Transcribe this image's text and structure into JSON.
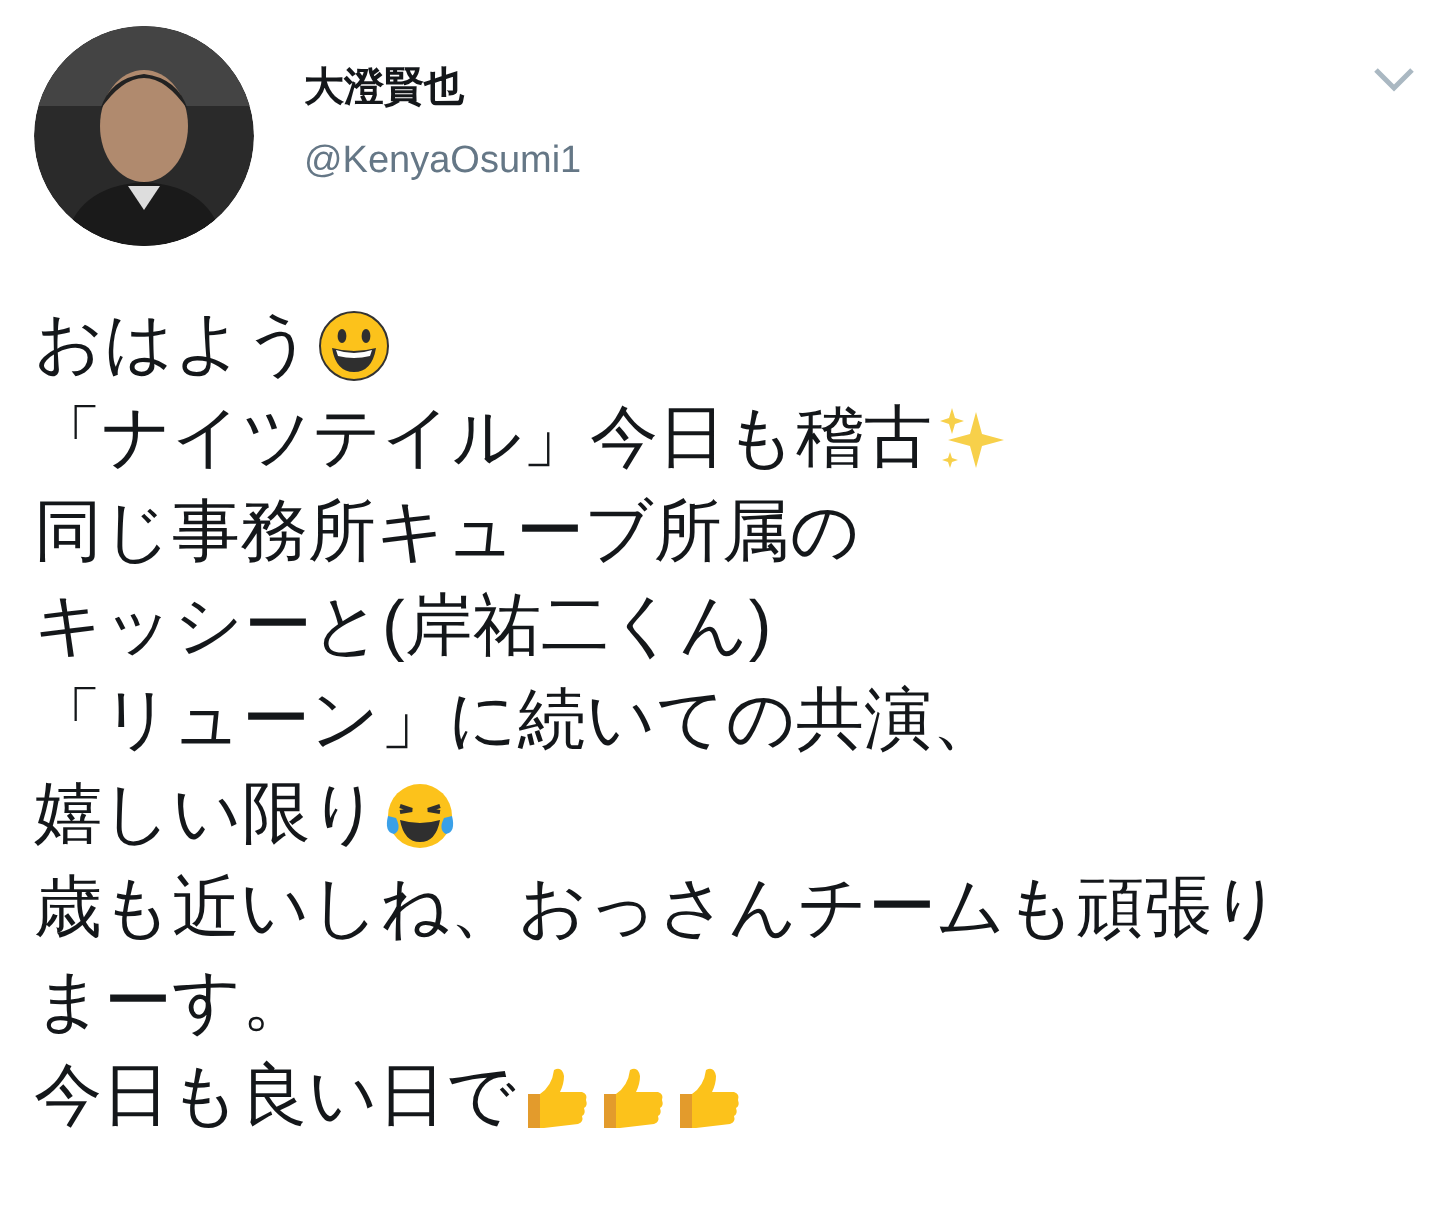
{
  "author": {
    "name": "大澄賢也",
    "handle": "@KenyaOsumi1"
  },
  "lines": [
    {
      "text": "おはよう",
      "emoji": [
        {
          "kind": "grin"
        }
      ]
    },
    {
      "text": "「ナイツテイル」今日も稽古",
      "emoji": [
        {
          "kind": "sparkles"
        }
      ]
    },
    {
      "text": "同じ事務所キューブ所属の"
    },
    {
      "text": "キッシーと(岸祐二くん)"
    },
    {
      "text": "「リューン」に続いての共演、"
    },
    {
      "text": "嬉しい限り",
      "emoji": [
        {
          "kind": "tears"
        }
      ]
    },
    {
      "text": "歳も近いしね、おっさんチームも頑張り"
    },
    {
      "text": "まーす。"
    },
    {
      "text": "今日も良い日で",
      "emoji": [
        {
          "kind": "thumb"
        },
        {
          "kind": "thumb"
        },
        {
          "kind": "thumb"
        }
      ]
    }
  ]
}
